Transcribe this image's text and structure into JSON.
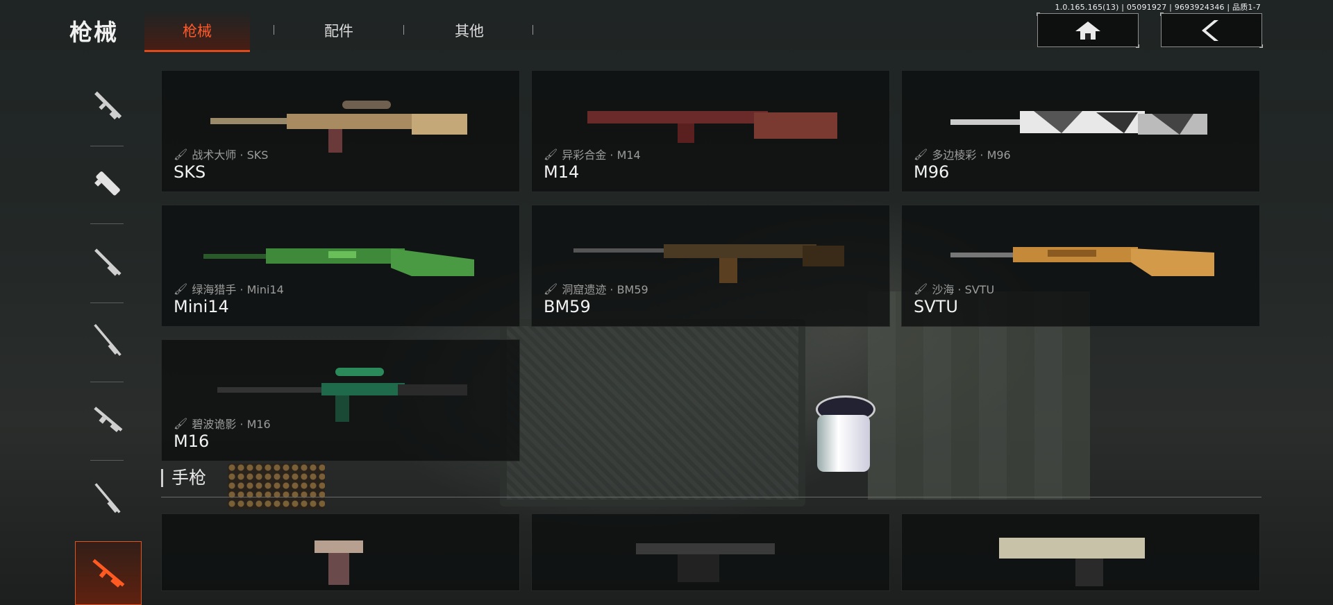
{
  "version": "1.0.165.165(13) | 05091927 | 9693924346 | 品质1-7",
  "header": {
    "title": "枪械",
    "tabs": [
      {
        "label": "枪械",
        "active": true
      },
      {
        "label": "配件",
        "active": false
      },
      {
        "label": "其他",
        "active": false
      }
    ]
  },
  "colors": {
    "accent": "#e04a1a",
    "card_bg": "#0e1010"
  },
  "sidebar": {
    "items": [
      {
        "icon": "assault-rifle-icon",
        "active": false
      },
      {
        "icon": "smg-icon",
        "active": false
      },
      {
        "icon": "shotgun-icon",
        "active": false
      },
      {
        "icon": "sniper-rifle-icon",
        "active": false
      },
      {
        "icon": "lmg-icon",
        "active": false
      },
      {
        "icon": "marksman-rifle-icon",
        "active": false
      },
      {
        "icon": "dmr-icon",
        "active": true
      }
    ]
  },
  "weapons": [
    {
      "skin": "战术大师 · SKS",
      "name": "SKS",
      "color": "#a88b60"
    },
    {
      "skin": "异彩合金 · M14",
      "name": "M14",
      "color": "#7a3a32"
    },
    {
      "skin": "多边棱彩 · M96",
      "name": "M96",
      "color": "#d8d8d8"
    },
    {
      "skin": "绿海猎手 · Mini14",
      "name": "Mini14",
      "color": "#3f8a3a"
    },
    {
      "skin": "洞窟遗迹 · BM59",
      "name": "BM59",
      "color": "#4a3a24"
    },
    {
      "skin": "沙海 · SVTU",
      "name": "SVTU",
      "color": "#c48a3a"
    },
    {
      "skin": "碧波诡影 · M16",
      "name": "M16",
      "color": "#1f6a4a"
    }
  ],
  "pistols_section": {
    "label": "手枪"
  },
  "pistols": [
    {
      "color": "#8a6060"
    },
    {
      "color": "#2a2a2a"
    },
    {
      "color": "#c8c2a8"
    }
  ]
}
